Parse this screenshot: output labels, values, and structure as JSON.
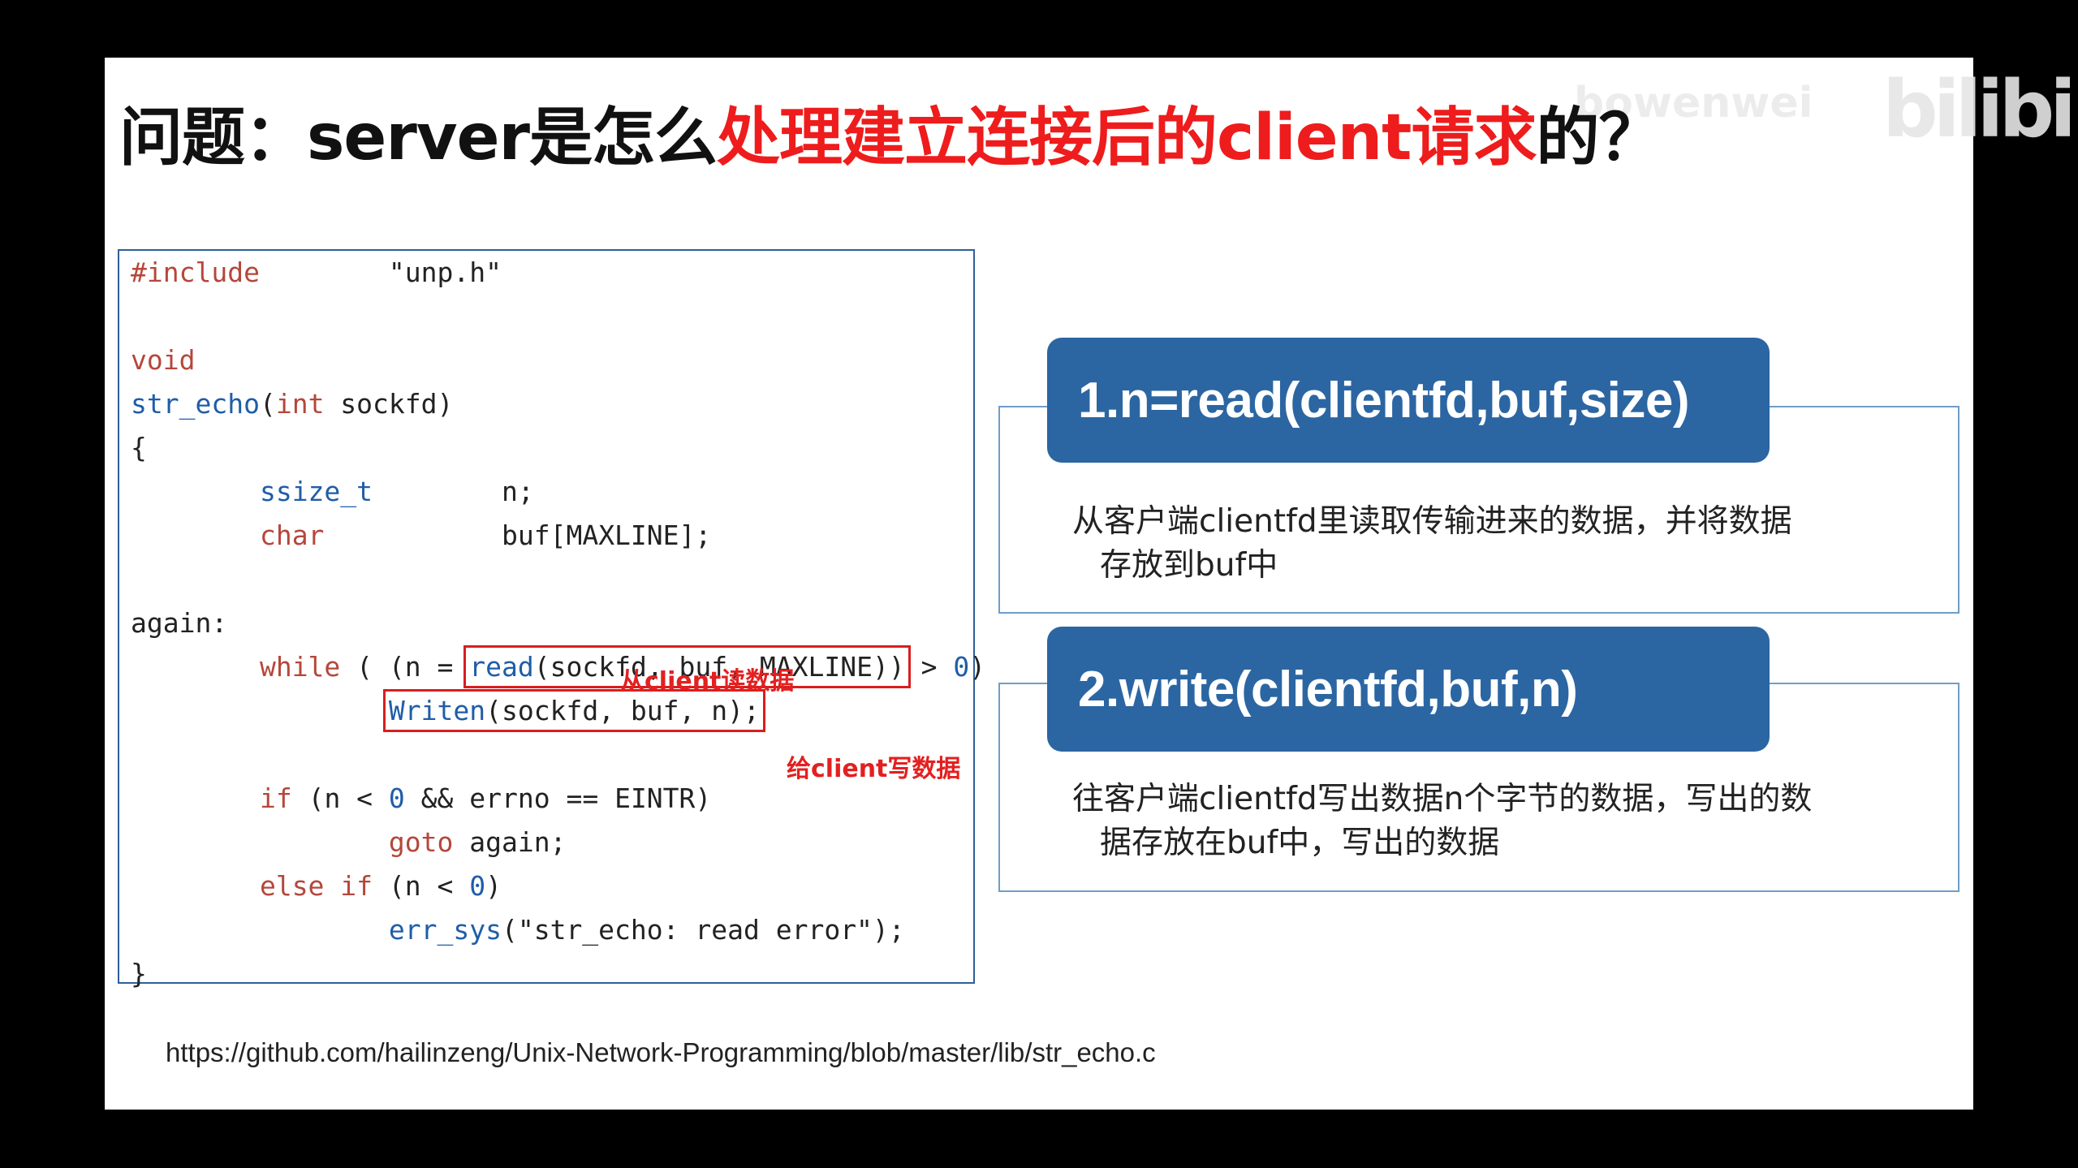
{
  "watermark": {
    "user": "bowenwei",
    "logo": "bilibili"
  },
  "title": {
    "prefix": "问题：server是怎么",
    "highlight": "处理建立连接后的client请求",
    "suffix": "的？"
  },
  "code": {
    "include_kw": "#include",
    "include_file": "\"unp.h\"",
    "void_kw": "void",
    "fn_name": "str_echo",
    "params_open": "(",
    "int_kw": "int",
    "params_rest": " sockfd)",
    "brace_open": "{",
    "ssize_t": "ssize_t",
    "n_decl": "n;",
    "char_kw": "char",
    "buf_decl": "buf[MAXLINE];",
    "label_again": "again:",
    "while_kw": "while",
    "while_cond_pre": " ( (n = ",
    "read_fn": "read",
    "read_args": "(sockfd, buf, MAXLINE))",
    "while_cond_post": " > ",
    "zero": "0",
    "close_paren": ")",
    "writen_fn": "Writen",
    "writen_args": "(sockfd, buf, n);",
    "if_kw": "if",
    "if_cond_pre": " (n < ",
    "if_cond_post": " && errno == EINTR)",
    "goto_kw": "goto",
    "goto_target": " again;",
    "else_if_kw": "else if",
    "elseif_cond_pre": " (n < ",
    "err_sys": "err_sys",
    "err_args": "(\"str_echo: read error\");",
    "brace_close": "}"
  },
  "notes": {
    "read_note": "从client读数据",
    "write_note": "给client写数据"
  },
  "steps": [
    {
      "label": "1.n=read(clientfd,buf,size)",
      "desc_line1": "从客户端clientfd里读取传输进来的数据，并将数据",
      "desc_line2": "存放到buf中"
    },
    {
      "label": "2.write(clientfd,buf,n)",
      "desc_line1": "往客户端clientfd写出数据n个字节的数据，写出的数",
      "desc_line2": "据存放在buf中，写出的数据"
    }
  ],
  "source_link": "https://github.com/hailinzeng/Unix-Network-Programming/blob/master/lib/str_echo.c",
  "colors": {
    "accent_red": "#ee1c1c",
    "pill_blue": "#2b66a3",
    "panel_border": "#6f9ec8",
    "code_border": "#2e5f9a"
  }
}
